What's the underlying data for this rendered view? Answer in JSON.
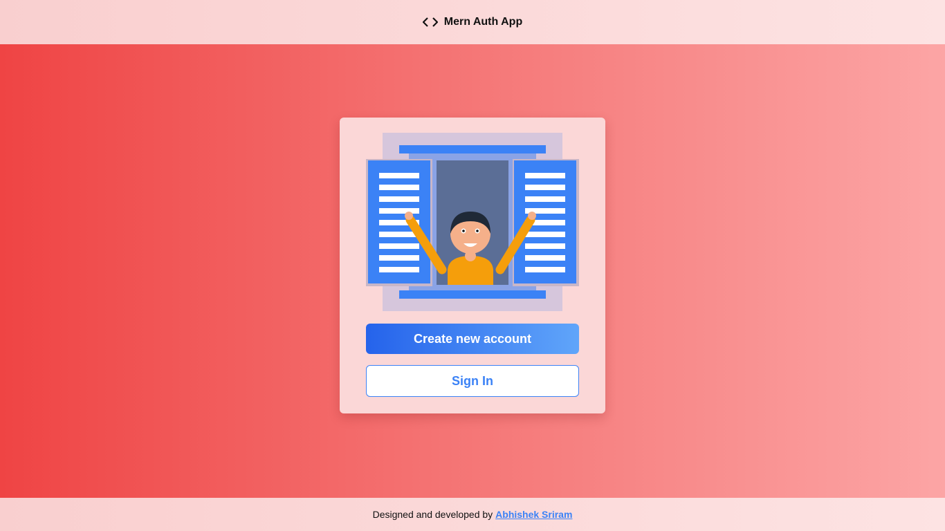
{
  "header": {
    "title": "Mern Auth App",
    "logo_icon": "code-brackets-icon"
  },
  "card": {
    "illustration": "person-opening-window-illustration",
    "create_account_label": "Create new account",
    "sign_in_label": "Sign In"
  },
  "footer": {
    "credit_text": "Designed and developed by",
    "author_name": "Abhishek Sriram"
  },
  "colors": {
    "accent_blue": "#3b82f6",
    "gradient_start": "#ef4444",
    "gradient_end": "#fca5a5",
    "card_bg": "#fbd7d7"
  }
}
